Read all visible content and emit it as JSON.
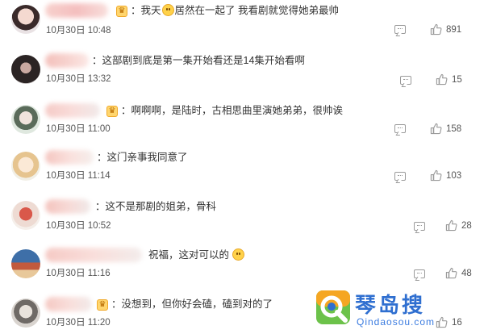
{
  "colors": {
    "text": "#333333",
    "muted": "#555555",
    "icon": "#9a9a9a",
    "badge": "#ffd66e",
    "watermark_blue": "#2f6fd0",
    "watermark_green": "#6cc24a"
  },
  "comments": [
    {
      "text_before": "：我天",
      "has_emoji": true,
      "text_after": "居然在一起了 我看剧就觉得她弟最帅",
      "time": "10月30日 10:48",
      "likes": "891",
      "has_badge": true
    },
    {
      "text_before": "：这部剧到底是第一集开始看还是14集开始看啊",
      "has_emoji": false,
      "text_after": "",
      "time": "10月30日 13:32",
      "likes": "15",
      "has_badge": false
    },
    {
      "text_before": "：啊啊啊，是陆时，古相思曲里演她弟弟，很帅诶",
      "has_emoji": false,
      "text_after": "",
      "time": "10月30日 11:00",
      "likes": "158",
      "has_badge": true
    },
    {
      "text_before": "：这门亲事我同意了",
      "has_emoji": false,
      "text_after": "",
      "time": "10月30日 11:14",
      "likes": "103",
      "has_badge": false
    },
    {
      "text_before": "：这不是那剧的姐弟，骨科",
      "has_emoji": false,
      "text_after": "",
      "time": "10月30日 10:52",
      "likes": "28",
      "has_badge": false
    },
    {
      "text_before": "祝福，这对可以的",
      "has_emoji": true,
      "text_after": "",
      "time": "10月30日 11:16",
      "likes": "48",
      "has_badge": false
    },
    {
      "text_before": "：没想到，但你好会磕，磕到对的了",
      "has_emoji": false,
      "text_after": "",
      "time": "10月30日 11:20",
      "likes": "16",
      "has_badge": true
    }
  ],
  "watermark": {
    "title": "琴岛搜",
    "url": "Qindaosou.com"
  }
}
